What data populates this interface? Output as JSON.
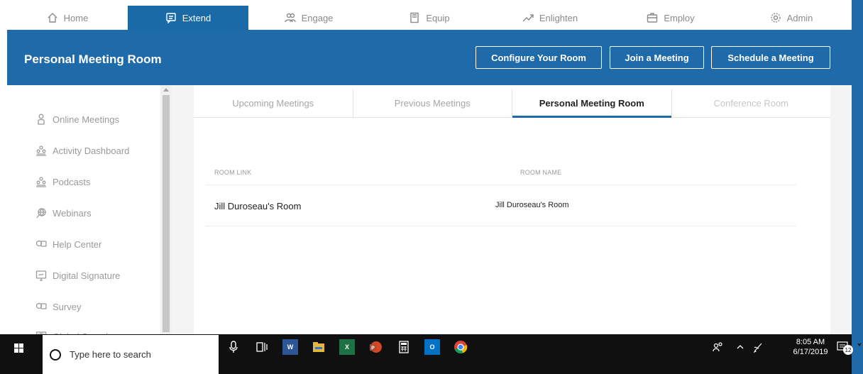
{
  "topnav": {
    "items": [
      {
        "label": "Home",
        "icon": "home-icon"
      },
      {
        "label": "Extend",
        "icon": "chat-icon",
        "active": true
      },
      {
        "label": "Engage",
        "icon": "people-icon"
      },
      {
        "label": "Equip",
        "icon": "book-icon"
      },
      {
        "label": "Enlighten",
        "icon": "trend-icon"
      },
      {
        "label": "Employ",
        "icon": "briefcase-icon"
      },
      {
        "label": "Admin",
        "icon": "gear-icon"
      }
    ]
  },
  "header": {
    "title": "Personal Meeting Room",
    "buttons": {
      "configure": "Configure Your Room",
      "join": "Join a Meeting",
      "schedule": "Schedule a Meeting"
    }
  },
  "sidebar": {
    "items": [
      {
        "label": "Online Meetings",
        "icon": "person-icon"
      },
      {
        "label": "Activity Dashboard",
        "icon": "group-icon"
      },
      {
        "label": "Podcasts",
        "icon": "group-icon"
      },
      {
        "label": "Webinars",
        "icon": "globe-icon"
      },
      {
        "label": "Help Center",
        "icon": "chat-bubbles-icon"
      },
      {
        "label": "Digital Signature",
        "icon": "signature-icon"
      },
      {
        "label": "Survey",
        "icon": "chat-bubbles-icon"
      },
      {
        "label": "Global Search",
        "icon": "search-grid-icon"
      }
    ]
  },
  "tabs": [
    {
      "label": "Upcoming Meetings"
    },
    {
      "label": "Previous Meetings"
    },
    {
      "label": "Personal Meeting Room",
      "active": true
    },
    {
      "label": "Conference Room"
    }
  ],
  "table": {
    "headers": {
      "link": "ROOM LINK",
      "name": "ROOM NAME"
    },
    "rows": [
      {
        "link": "Jill Duroseau's Room",
        "name": "Jill Duroseau's Room"
      }
    ]
  },
  "taskbar": {
    "search_placeholder": "Type here to search",
    "time": "8:05 AM",
    "date": "6/17/2019",
    "notification_count": "12"
  },
  "colors": {
    "brand": "#1f6aa8",
    "taskbar": "#101010"
  }
}
